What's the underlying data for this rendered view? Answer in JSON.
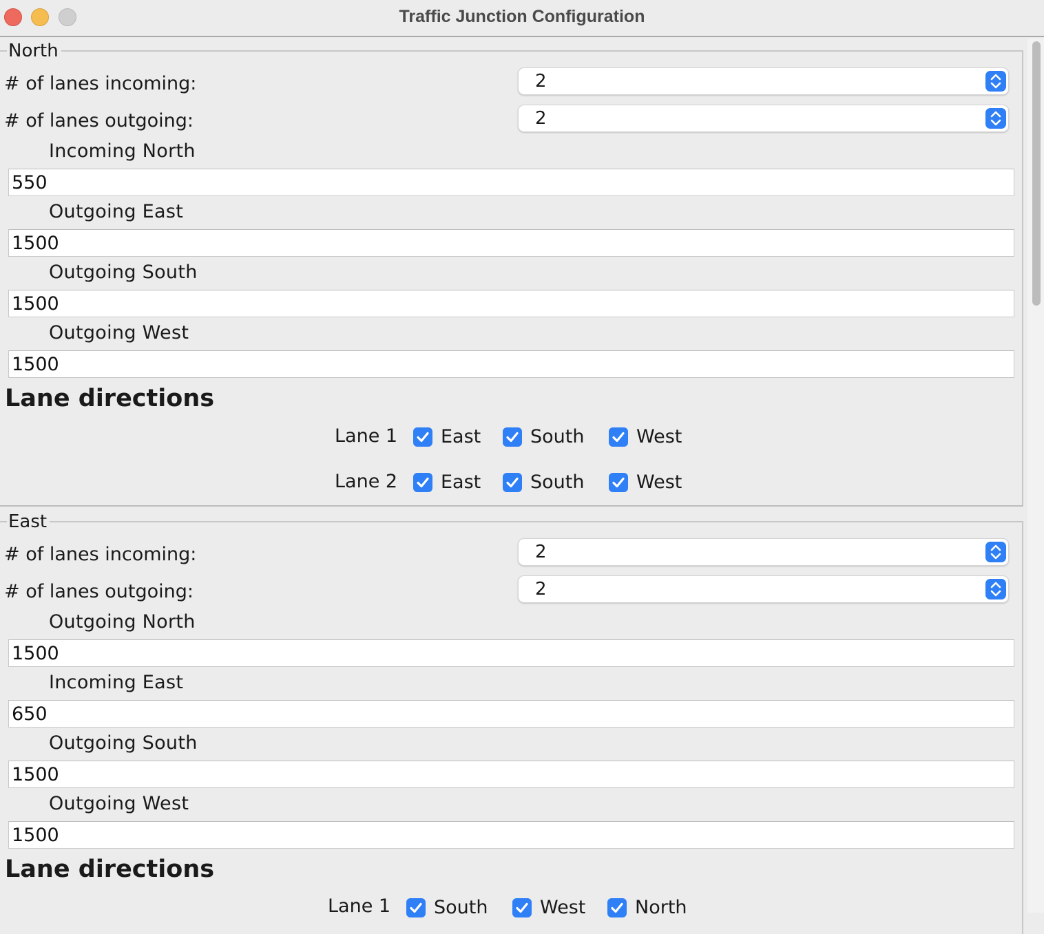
{
  "window": {
    "title": "Traffic Junction Configuration"
  },
  "panels": [
    {
      "legend": "North",
      "incoming_label": "# of lanes incoming:",
      "incoming_value": "2",
      "outgoing_label": "# of lanes outgoing:",
      "outgoing_value": "2",
      "fields": [
        {
          "label": "Incoming North",
          "value": "550"
        },
        {
          "label": "Outgoing East",
          "value": "1500"
        },
        {
          "label": "Outgoing South",
          "value": "1500"
        },
        {
          "label": "Outgoing West",
          "value": "1500"
        }
      ],
      "lane_heading": "Lane directions",
      "lanes": [
        {
          "label": "Lane 1",
          "options": [
            {
              "label": "East",
              "checked": true
            },
            {
              "label": "South",
              "checked": true
            },
            {
              "label": "West",
              "checked": true
            }
          ]
        },
        {
          "label": "Lane 2",
          "options": [
            {
              "label": "East",
              "checked": true
            },
            {
              "label": "South",
              "checked": true
            },
            {
              "label": "West",
              "checked": true
            }
          ]
        }
      ]
    },
    {
      "legend": "East",
      "incoming_label": "# of lanes incoming:",
      "incoming_value": "2",
      "outgoing_label": "# of lanes outgoing:",
      "outgoing_value": "2",
      "fields": [
        {
          "label": "Outgoing North",
          "value": "1500"
        },
        {
          "label": "Incoming East",
          "value": "650"
        },
        {
          "label": "Outgoing South",
          "value": "1500"
        },
        {
          "label": "Outgoing West",
          "value": "1500"
        }
      ],
      "lane_heading": "Lane directions",
      "lanes": [
        {
          "label": "Lane 1",
          "options": [
            {
              "label": "South",
              "checked": true
            },
            {
              "label": "West",
              "checked": true
            },
            {
              "label": "North",
              "checked": true
            }
          ]
        }
      ]
    }
  ],
  "colors": {
    "accent": "#2f7ff7",
    "window_bg": "#ececec"
  },
  "icons": {
    "combo_arrow": "up-down-chevron-icon",
    "checkbox": "checkmark-icon",
    "window_controls": [
      "close-icon",
      "minimize-icon",
      "zoom-icon"
    ]
  }
}
